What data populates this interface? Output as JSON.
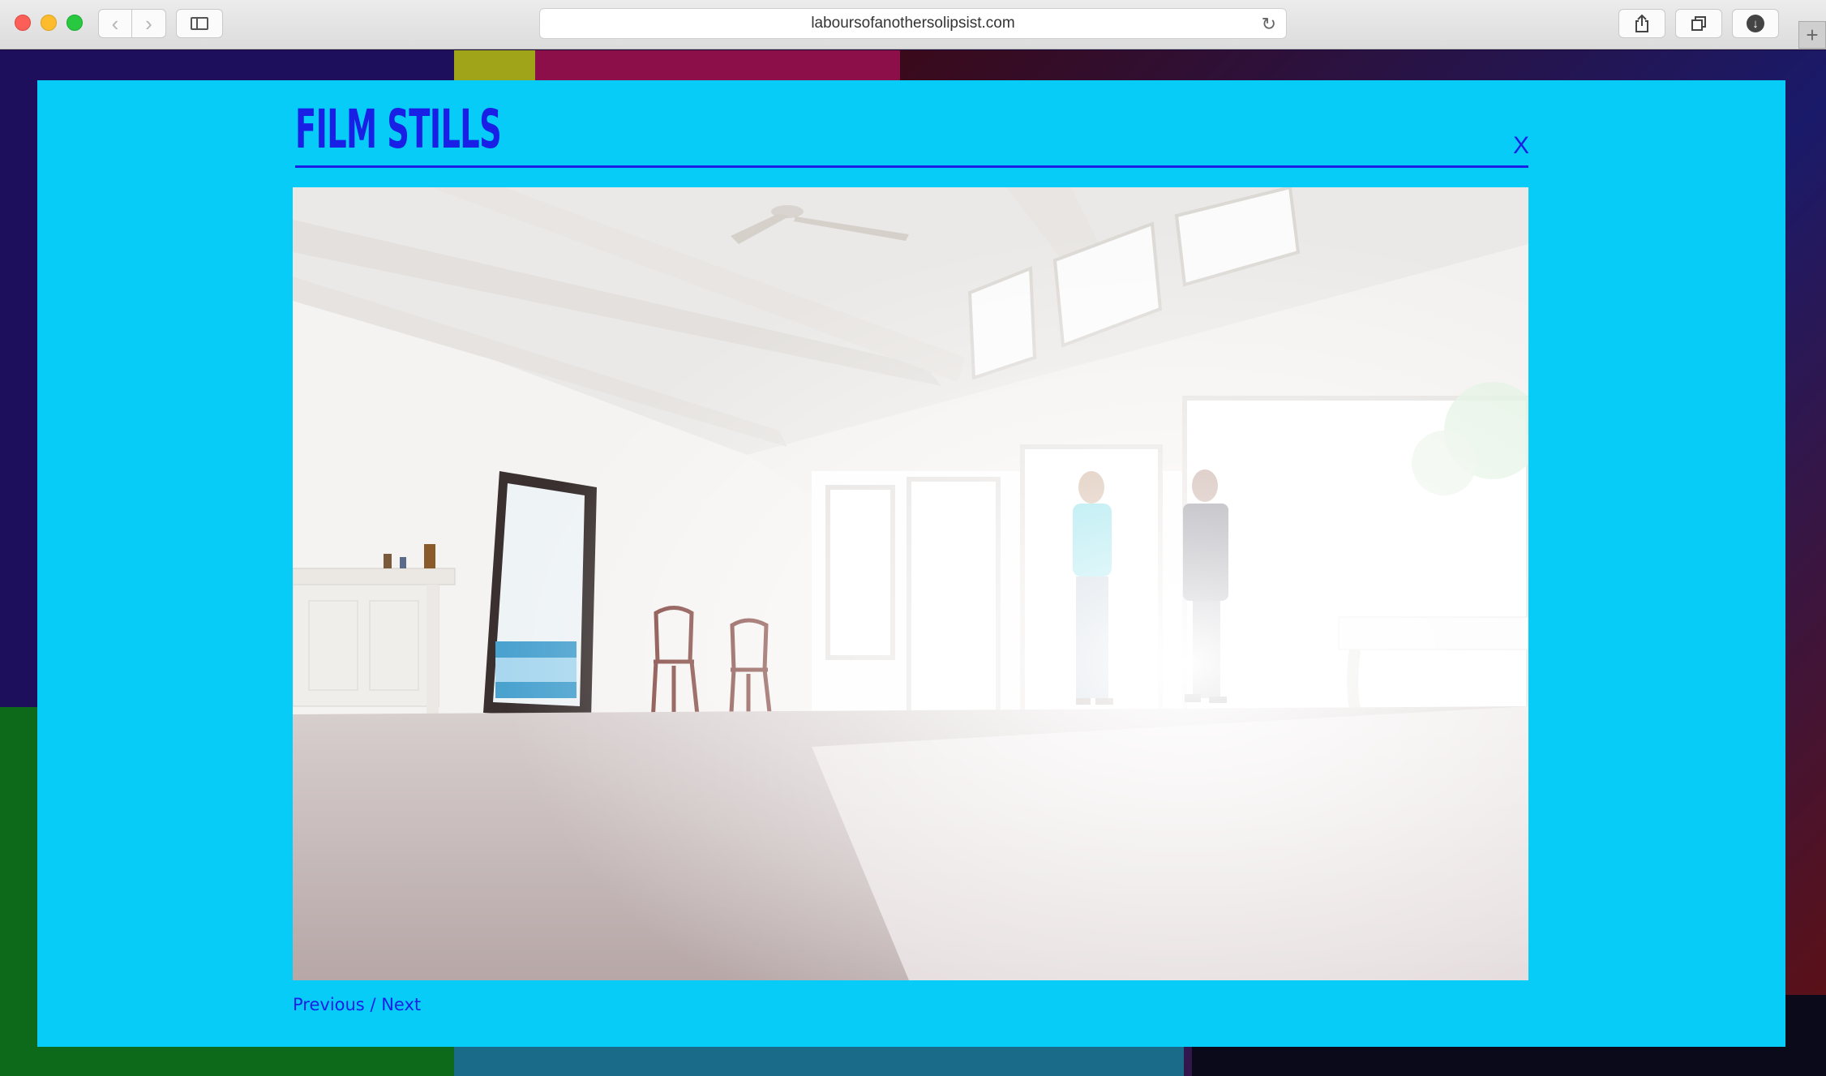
{
  "browser": {
    "url": "laboursofanothersolipsist.com",
    "icons": {
      "back": "chevron-left-icon",
      "forward": "chevron-right-icon",
      "sidebar": "sidebar-icon",
      "reload": "reload-icon",
      "share": "share-icon",
      "tabs": "tabs-overview-icon",
      "download": "download-icon",
      "new_tab": "plus-icon"
    }
  },
  "modal": {
    "title": "FILM STILLS",
    "close_label": "X",
    "accent_color": "#1a1fe6",
    "background_color": "#07ccf8",
    "pager": {
      "previous": "Previous",
      "separator": "/",
      "next": "Next"
    }
  }
}
